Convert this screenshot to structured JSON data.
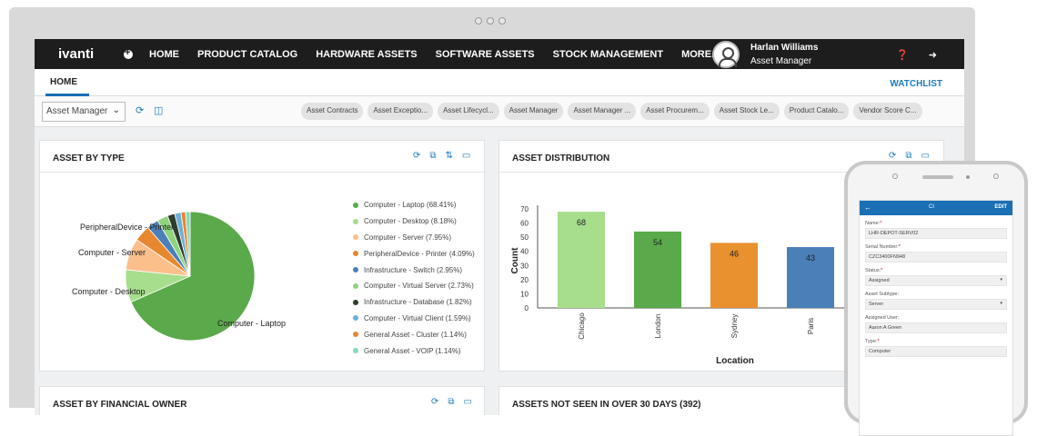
{
  "nav": {
    "logo": "ivanti",
    "items": [
      "HOME",
      "PRODUCT CATALOG",
      "HARDWARE ASSETS",
      "SOFTWARE ASSETS",
      "STOCK MANAGEMENT",
      "MORE..."
    ],
    "user_name": "Harlan Williams",
    "user_role": "Asset Manager"
  },
  "tabbar": {
    "home": "HOME",
    "watchlist": "WATCHLIST"
  },
  "toolbar": {
    "role_select": "Asset Manager",
    "chips": [
      "Asset Contracts",
      "Asset Exceptio...",
      "Asset Lifecycl...",
      "Asset Manager",
      "Asset Manager ...",
      "Asset Procurem...",
      "Asset Stock Le...",
      "Product Catalo...",
      "Vendor Score C..."
    ]
  },
  "panels": {
    "by_type_title": "ASSET BY TYPE",
    "distribution_title": "ASSET DISTRIBUTION",
    "financial_title": "ASSET BY FINANCIAL OWNER",
    "not_seen_title": "ASSETS NOT SEEN IN OVER 30 DAYS (392)"
  },
  "chart_data": [
    {
      "type": "pie",
      "title": "ASSET BY TYPE",
      "slices": [
        {
          "label": "Computer - Laptop",
          "legend": "Computer - Laptop (68.41%)",
          "value": 68.41,
          "color": "#5aa94a"
        },
        {
          "label": "Computer - Desktop",
          "legend": "Computer - Desktop (8.18%)",
          "value": 8.18,
          "color": "#a6de8c"
        },
        {
          "label": "Computer - Server",
          "legend": "Computer - Server (7.95%)",
          "value": 7.95,
          "color": "#fbbf8c"
        },
        {
          "label": "PeripheralDevice - Printer",
          "legend": "PeripheralDevice - Printer (4.09%)",
          "value": 4.09,
          "color": "#e8872e"
        },
        {
          "label": "Infrastructure - Switch",
          "legend": "Infrastructure - Switch (2.95%)",
          "value": 2.95,
          "color": "#4a7fb8"
        },
        {
          "label": "Computer - Virtual Server",
          "legend": "Computer - Virtual Server (2.73%)",
          "value": 2.73,
          "color": "#8fd47e"
        },
        {
          "label": "Infrastructure - Database",
          "legend": "Infrastructure - Database (1.82%)",
          "value": 1.82,
          "color": "#2f3d2c"
        },
        {
          "label": "Computer - Virtual Client",
          "legend": "Computer - Virtual Client (1.59%)",
          "value": 1.59,
          "color": "#6fb0da"
        },
        {
          "label": "General Asset - Cluster",
          "legend": "General Asset - Cluster (1.14%)",
          "value": 1.14,
          "color": "#e8862e"
        },
        {
          "label": "General Asset - VOIP",
          "legend": "General Asset - VOIP (1.14%)",
          "value": 1.14,
          "color": "#86d9c0"
        }
      ],
      "outside_labels": [
        "PeripheralDevice - Printer",
        "Computer - Server",
        "Computer - Desktop",
        "Computer - Laptop"
      ]
    },
    {
      "type": "bar",
      "title": "ASSET DISTRIBUTION",
      "categories": [
        "Chicago",
        "London",
        "Sydney",
        "Paris"
      ],
      "values": [
        68,
        54,
        46,
        43
      ],
      "colors": [
        "#a6de8c",
        "#5aa94a",
        "#e8912e",
        "#4a7fb8"
      ],
      "xlabel": "Location",
      "ylabel": "Count",
      "ylim": [
        0,
        70
      ],
      "yticks": [
        0,
        10,
        20,
        30,
        40,
        50,
        60,
        70
      ]
    }
  ],
  "phone": {
    "header_title": "CI",
    "header_edit": "EDIT",
    "fields": [
      {
        "label": "Name:",
        "required": true,
        "value": "LHR-DEPOT-SERV02"
      },
      {
        "label": "Serial Number:",
        "required": true,
        "value": "CZC3400FN948"
      },
      {
        "label": "Status:",
        "required": true,
        "value": "Assigned"
      },
      {
        "label": "Asset Subtype:",
        "required": false,
        "value": "Server"
      },
      {
        "label": "Assigned User:",
        "required": false,
        "value": "Aaron A Green"
      },
      {
        "label": "Type:",
        "required": true,
        "value": "Computer"
      }
    ]
  }
}
